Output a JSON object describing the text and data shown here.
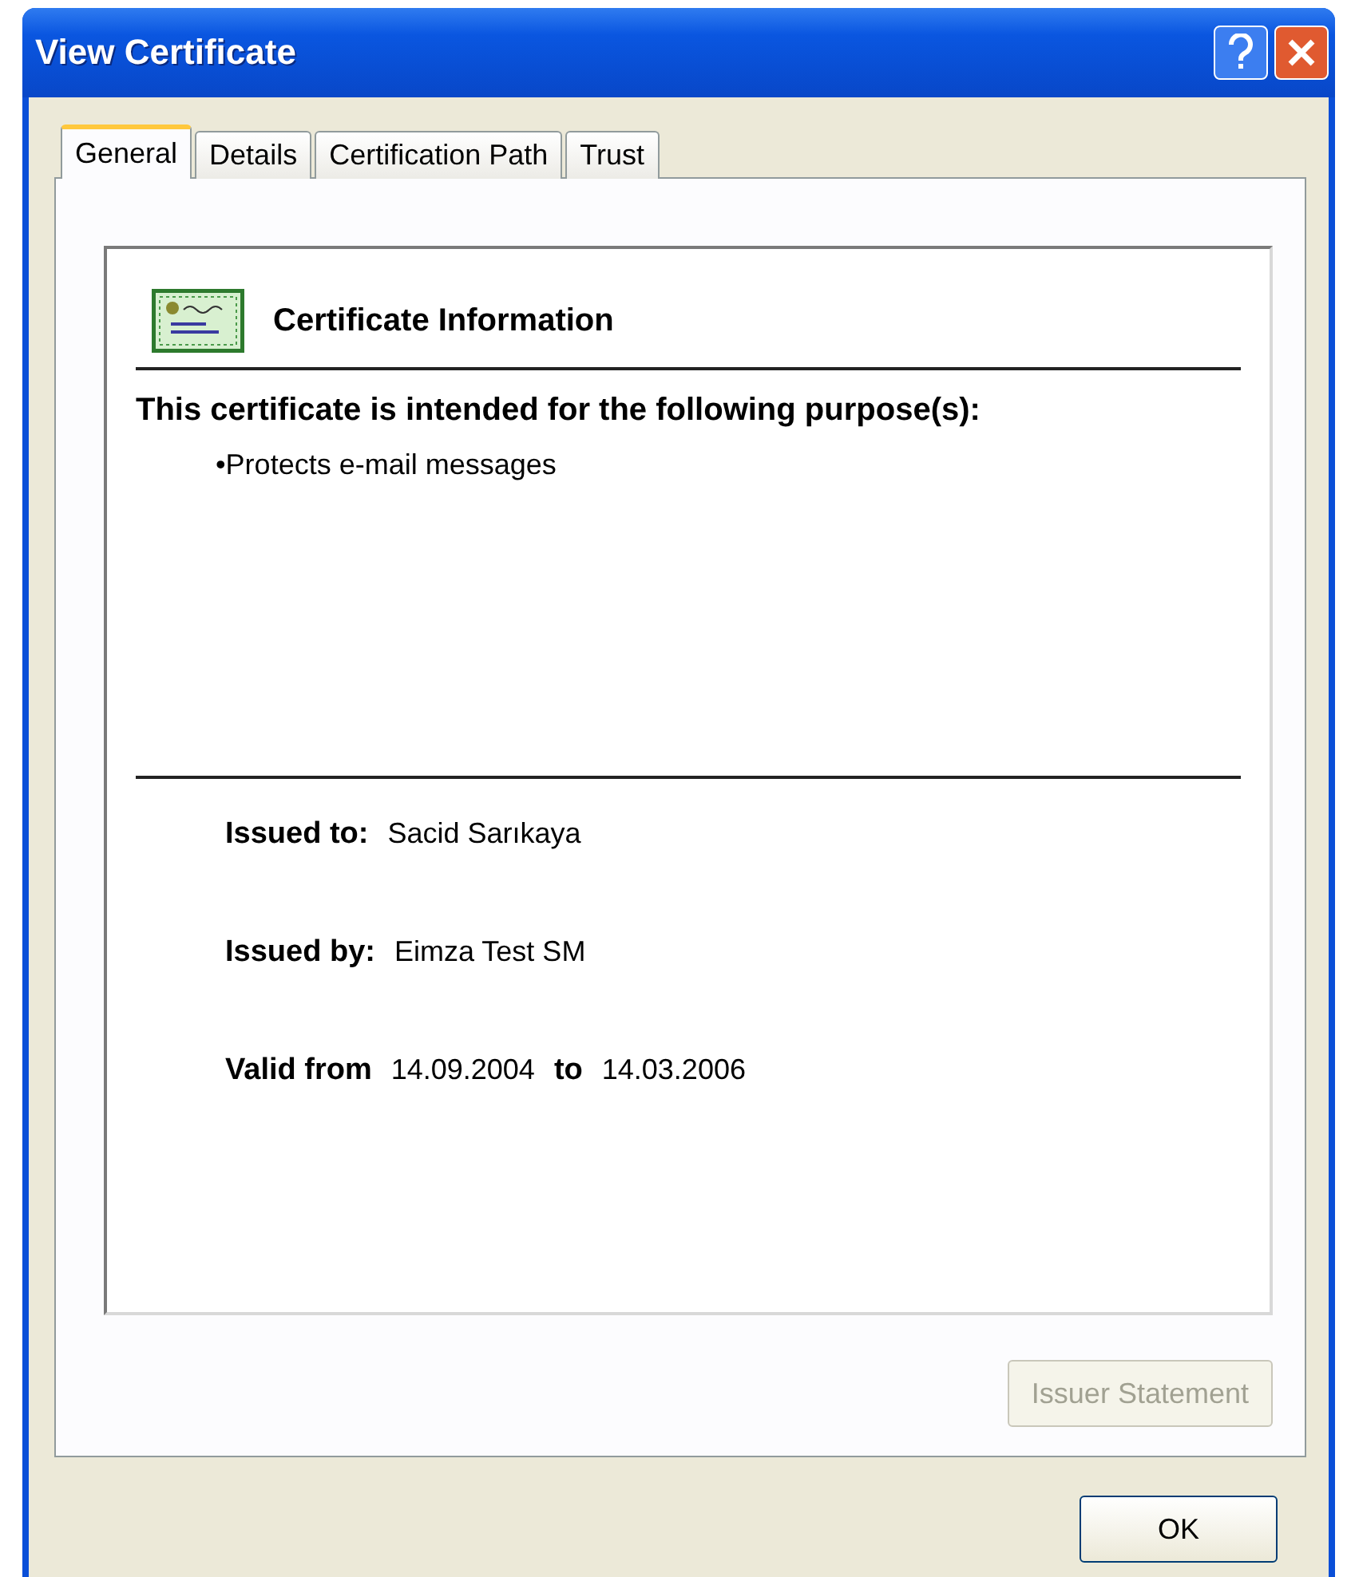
{
  "window": {
    "title": "View Certificate"
  },
  "tabs": [
    {
      "label": "General",
      "selected": true
    },
    {
      "label": "Details",
      "selected": false
    },
    {
      "label": "Certification Path",
      "selected": false
    },
    {
      "label": "Trust",
      "selected": false
    }
  ],
  "info": {
    "heading": "Certificate Information",
    "purpose_title": "This certificate is intended for the following purpose(s):",
    "purposes": [
      "•Protects e-mail messages"
    ],
    "issued_to_label": "Issued to:",
    "issued_to": "Sacid Sarıkaya",
    "issued_by_label": "Issued by:",
    "issued_by": "Eimza Test SM",
    "valid_from_label": "Valid from",
    "valid_from": "14.09.2004",
    "to_label": "to",
    "valid_to": "14.03.2006"
  },
  "issuer_statement": {
    "label": "Issuer Statement",
    "disabled": true
  },
  "ok_button": {
    "label": "OK"
  }
}
